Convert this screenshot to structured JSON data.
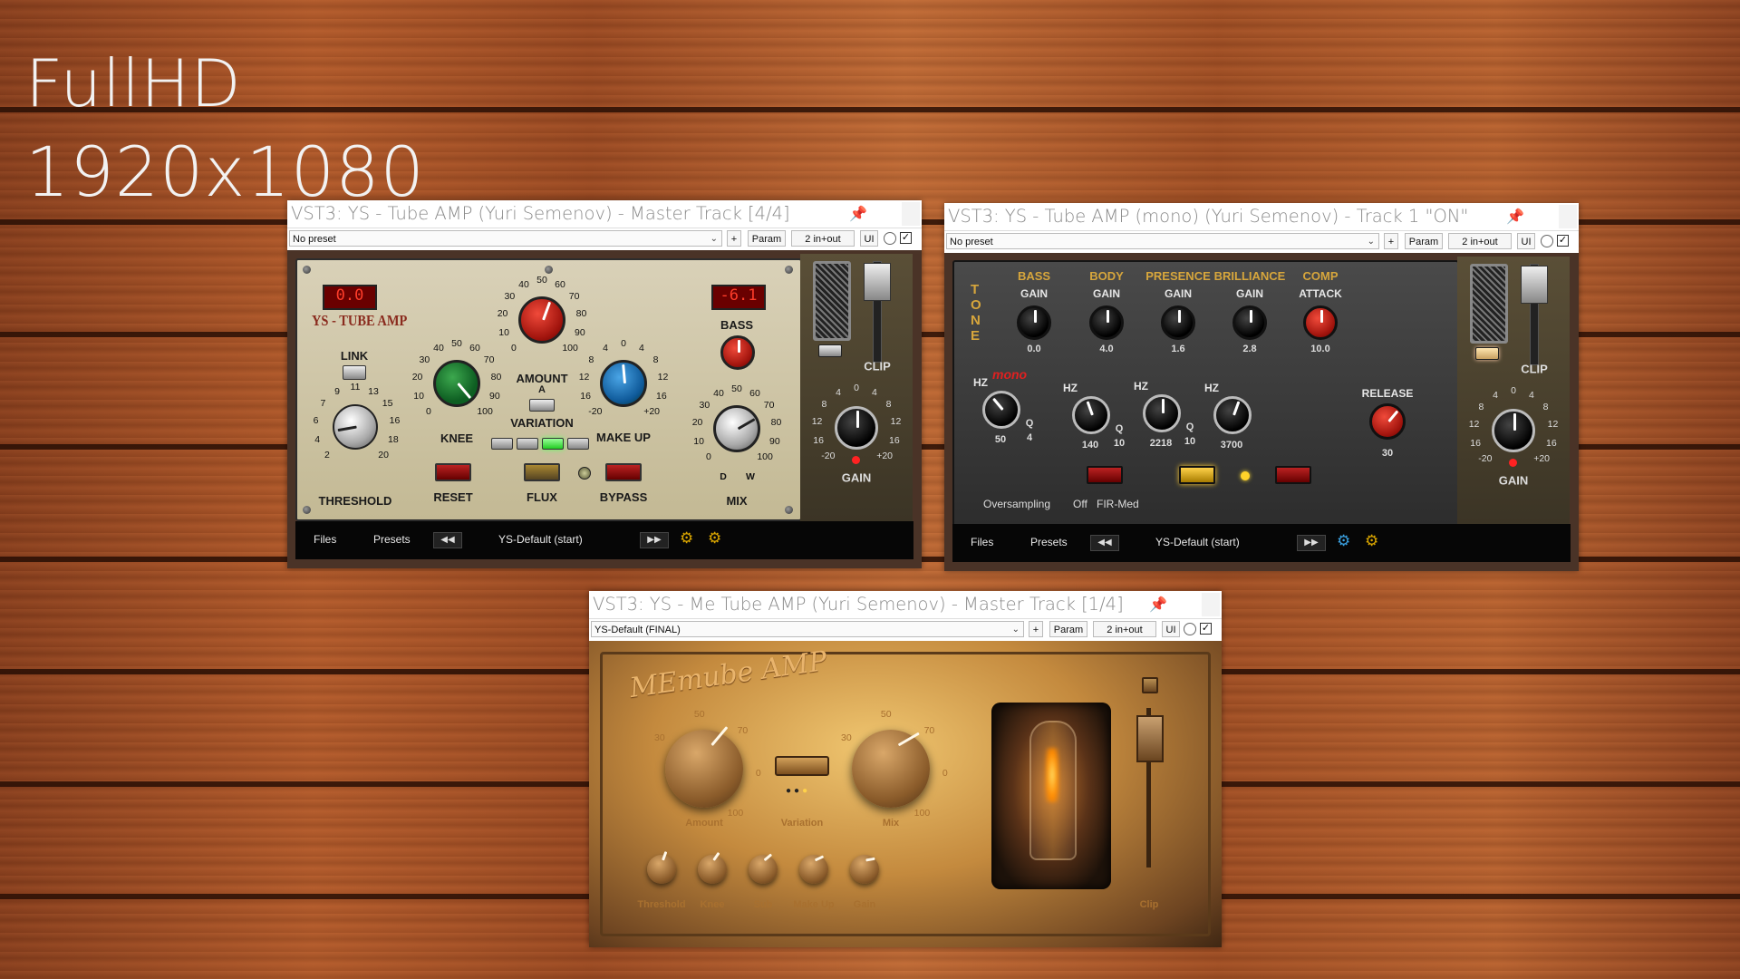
{
  "watermark": {
    "line1": "FullHD",
    "line2": "1920x1080"
  },
  "win1": {
    "title": "VST3: YS - Tube AMP (Yuri Semenov) - Master Track [4/4]",
    "toolbar": {
      "preset": "No preset",
      "plus": "+",
      "param": "Param",
      "io": "2 in+out",
      "ui": "UI"
    },
    "plugin": {
      "brand": "YS - TUBE AMP",
      "left_meter": "0.0",
      "right_meter": "-6.1",
      "labels": {
        "link": "LINK",
        "threshold": "THRESHOLD",
        "knee": "KNEE",
        "reset": "RESET",
        "amount": "AMOUNT",
        "a": "A",
        "variation": "VARIATION",
        "flux": "FLUX",
        "bypass": "BYPASS",
        "makeup": "MAKE UP",
        "bass": "BASS",
        "mix": "MIX",
        "clip": "CLIP",
        "gain": "GAIN"
      },
      "threshold_scale": [
        "2",
        "4",
        "6",
        "7",
        "9",
        "11",
        "13",
        "15",
        "16",
        "18",
        "20"
      ],
      "knee_scale": [
        "0",
        "10",
        "20",
        "30",
        "40",
        "50",
        "60",
        "70",
        "80",
        "90",
        "100"
      ],
      "amount_scale": [
        "0",
        "10",
        "20",
        "30",
        "40",
        "50",
        "60",
        "70",
        "80",
        "90",
        "100"
      ],
      "makeup_scale": [
        "-20",
        "16",
        "12",
        "8",
        "4",
        "0",
        "4",
        "8",
        "12",
        "16",
        "+20"
      ],
      "mix_scale": [
        "0",
        "10",
        "20",
        "30",
        "40",
        "50",
        "60",
        "70",
        "80",
        "90",
        "100"
      ],
      "mix_dw": [
        "D",
        "W"
      ],
      "gain_scale": [
        "-20",
        "16",
        "12",
        "8",
        "4",
        "0",
        "4",
        "8",
        "12",
        "16",
        "+20"
      ]
    },
    "bottom": {
      "files": "Files",
      "presets": "Presets",
      "preset_name": "YS-Default (start)",
      "prev": "◀◀",
      "next": "▶▶"
    }
  },
  "win2": {
    "title": "VST3: YS - Tube AMP (mono) (Yuri Semenov) - Track 1 \"ON\"",
    "toolbar": {
      "preset": "No preset",
      "plus": "+",
      "param": "Param",
      "io": "2 in+out",
      "ui": "UI"
    },
    "plugin": {
      "tone": "T O N E",
      "mono": "mono",
      "sections": [
        {
          "title": "BASS",
          "sub": "GAIN",
          "value": "0.0"
        },
        {
          "title": "BODY",
          "sub": "GAIN",
          "value": "4.0"
        },
        {
          "title": "PRESENCE",
          "sub": "GAIN",
          "value": "1.6"
        },
        {
          "title": "BRILLIANCE",
          "sub": "GAIN",
          "value": "2.8"
        },
        {
          "title": "COMP",
          "sub": "ATTACK",
          "value": "10.0"
        }
      ],
      "hz": [
        {
          "label": "HZ",
          "value": "50",
          "q": "4"
        },
        {
          "label": "HZ",
          "value": "140",
          "q": "10"
        },
        {
          "label": "HZ",
          "value": "2218",
          "q": "10"
        },
        {
          "label": "HZ",
          "value": "3700",
          "q": ""
        }
      ],
      "q_label": "Q",
      "release": "RELEASE",
      "release_value": "30",
      "oversampling": "Oversampling",
      "os_off": "Off",
      "os_fir": "FIR-Med",
      "clip": "CLIP",
      "gain": "GAIN",
      "gain_scale": [
        "-20",
        "16",
        "12",
        "8",
        "4",
        "0",
        "4",
        "8",
        "12",
        "16",
        "+20"
      ]
    },
    "bottom": {
      "files": "Files",
      "presets": "Presets",
      "preset_name": "YS-Default (start)",
      "prev": "◀◀",
      "next": "▶▶"
    }
  },
  "win3": {
    "title": "VST3: YS - Me Tube AMP (Yuri Semenov) - Master Track [1/4]",
    "toolbar": {
      "preset": "YS-Default (FINAL)",
      "plus": "+",
      "param": "Param",
      "io": "2 in+out",
      "ui": "UI"
    },
    "plugin": {
      "brand": "MEтube AMP",
      "amount": "Amount",
      "variation": "Variation",
      "mix": "Mix",
      "amount_scale": [
        "30",
        "50",
        "70",
        "0",
        "100"
      ],
      "mix_scale": [
        "30",
        "50",
        "70",
        "0",
        "100"
      ],
      "small_knobs": [
        "Threshold",
        "Knee",
        "Sub",
        "Make Up",
        "Gain"
      ],
      "clip": "Clip"
    }
  }
}
